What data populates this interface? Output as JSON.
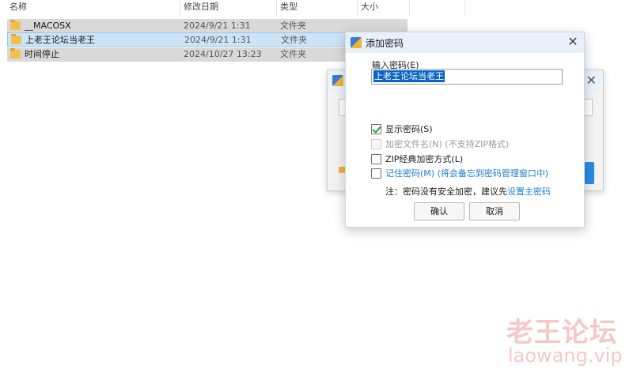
{
  "explorer": {
    "columns": {
      "name": "名称",
      "date": "修改日期",
      "type": "类型",
      "size": "大小"
    },
    "rows": [
      {
        "name": "__MACOSX",
        "date": "2024/9/21 1:31",
        "type": "文件夹"
      },
      {
        "name": "上老王论坛当老王",
        "date": "2024/9/21 1:31",
        "type": "文件夹"
      },
      {
        "name": "时间停止",
        "date": "2024/10/27 13:23",
        "type": "文件夹"
      }
    ]
  },
  "dialog": {
    "title": "添加密码",
    "close": "✕",
    "password_label": "输入密码(E)",
    "password_value": "上老王论坛当老王",
    "options": {
      "show_password": {
        "label": "显示密码(S)",
        "checked": true
      },
      "encrypt_filenames": {
        "label": "加密文件名(N) (不支持ZIP格式)",
        "disabled": true
      },
      "zip_classic": {
        "label": "ZIP经典加密方式(L)",
        "checked": false
      },
      "remember_password": {
        "label": "记住密码(M) (将会备忘到密码管理窗口中)",
        "checked": false
      }
    },
    "note_prefix": "注：密码没有安全加密，建议先",
    "note_link": "设置主密码",
    "ok_label": "确认",
    "cancel_label": "取消"
  },
  "background_dialog": {
    "close": "✕"
  },
  "watermark": {
    "line1": "老王论坛",
    "line2": "laowang.vip"
  },
  "colors": {
    "selection_blue": "#cce4f7",
    "link_blue": "#1f7fd3",
    "folder_yellow": "#f3c04d",
    "check_green": "#2a9d3a",
    "watermark": "#f09a9a"
  }
}
